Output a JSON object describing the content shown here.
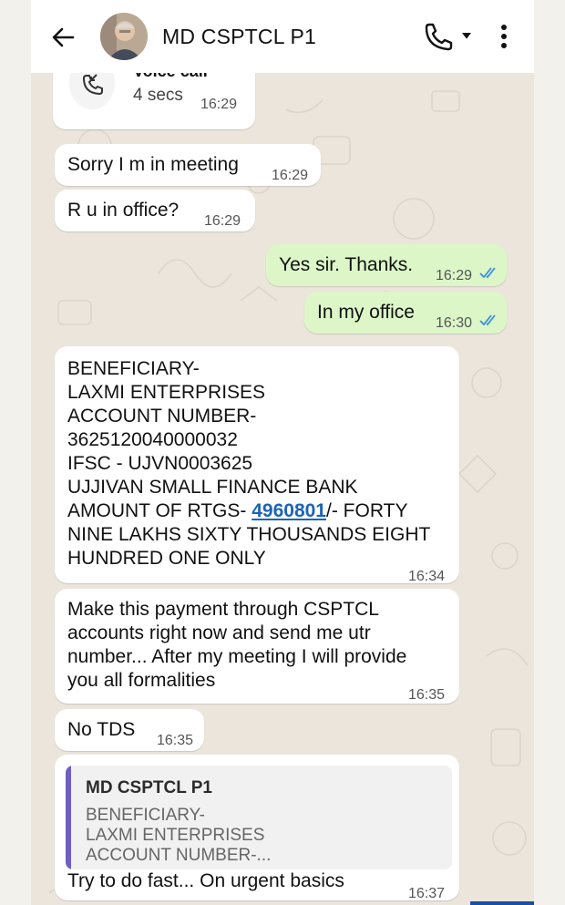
{
  "header": {
    "contact_name": "MD CSPTCL P1",
    "back_icon": "arrow-left-icon",
    "call_icon": "phone-icon",
    "dropdown_icon": "caret-down-icon",
    "more_icon": "more-vertical-icon"
  },
  "call_log": {
    "label": "Voice call",
    "duration": "4 secs",
    "time": "16:29",
    "icon": "missed-call-icon"
  },
  "messages": [
    {
      "direction": "in",
      "lines": [
        "Sorry I m in meeting"
      ],
      "time": "16:29"
    },
    {
      "direction": "in",
      "lines": [
        "R u in office?"
      ],
      "time": "16:29"
    },
    {
      "direction": "out",
      "lines": [
        "Yes sir. Thanks."
      ],
      "time": "16:29",
      "status": "read"
    },
    {
      "direction": "out",
      "lines": [
        "In my office"
      ],
      "time": "16:30",
      "status": "read"
    },
    {
      "direction": "in",
      "lines": [
        "BENEFICIARY-",
        "LAXMI ENTERPRISES",
        "ACCOUNT NUMBER-",
        "3625120040000032",
        "IFSC - UJVN0003625",
        "UJJIVAN SMALL FINANCE BANK",
        "AMOUNT OF RTGS- ",
        "NINE LAKHS SIXTY THOUSANDS EIGHT",
        "HUNDRED ONE ONLY"
      ],
      "link": "4960801",
      "link_suffix": "/- FORTY",
      "time": "16:34"
    },
    {
      "direction": "in",
      "lines": [
        "Make this payment through CSPTCL",
        "accounts right now and send me utr",
        "number... After my meeting I will provide",
        "you all formalities"
      ],
      "time": "16:35"
    },
    {
      "direction": "in",
      "lines": [
        "No TDS"
      ],
      "time": "16:35"
    },
    {
      "direction": "in",
      "quote": {
        "author": "MD CSPTCL P1",
        "lines": [
          "BENEFICIARY-",
          "LAXMI ENTERPRISES",
          "ACCOUNT NUMBER-..."
        ]
      },
      "lines": [
        "Try to do fast... On urgent basics"
      ],
      "time": "16:37"
    }
  ],
  "colors": {
    "incoming_bubble": "#ffffff",
    "outgoing_bubble": "#dcf6c8",
    "read_ticks": "#3b8fd9",
    "link": "#1c63b8",
    "quote_bar": "#6e5fc1"
  }
}
